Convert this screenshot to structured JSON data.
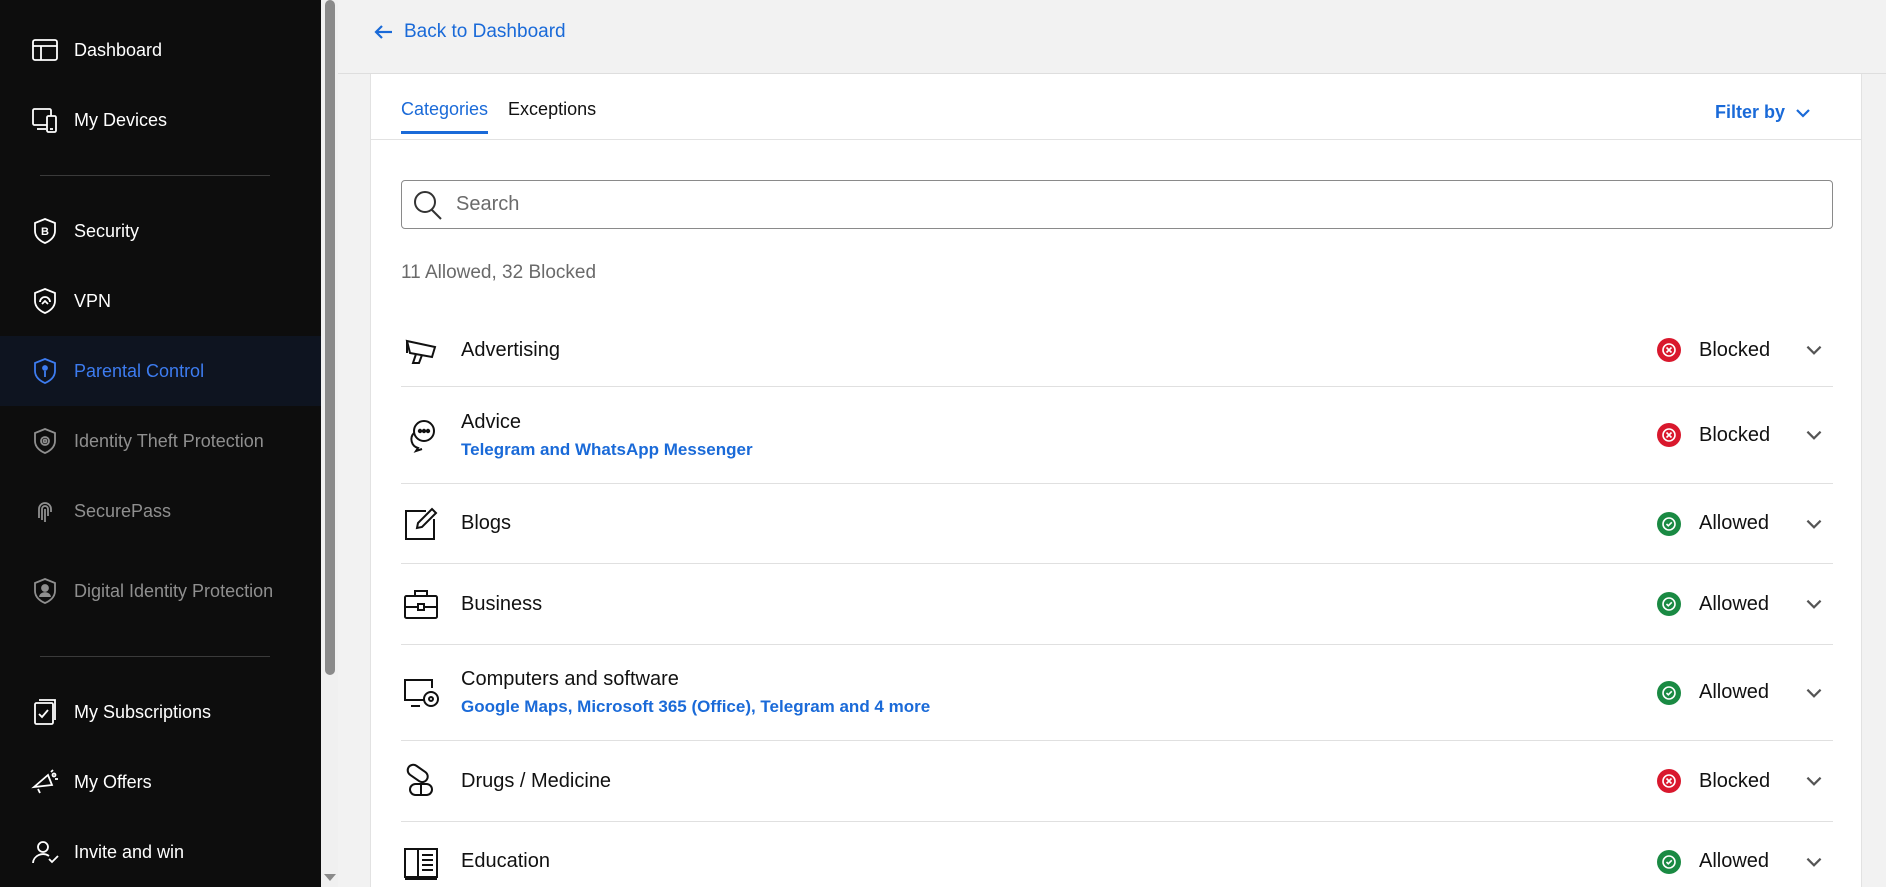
{
  "sidebar": {
    "items": [
      {
        "label": "Dashboard",
        "icon": "dashboard-icon"
      },
      {
        "label": "My Devices",
        "icon": "devices-icon"
      },
      {
        "label": "Security",
        "icon": "security-shield-icon"
      },
      {
        "label": "VPN",
        "icon": "vpn-shield-icon"
      },
      {
        "label": "Parental Control",
        "icon": "parental-shield-icon",
        "active": true
      },
      {
        "label": "Identity Theft Protection",
        "icon": "identity-shield-icon"
      },
      {
        "label": "SecurePass",
        "icon": "fingerprint-icon"
      },
      {
        "label": "Digital Identity Protection",
        "icon": "digital-identity-icon"
      },
      {
        "label": "My Subscriptions",
        "icon": "subscriptions-icon"
      },
      {
        "label": "My Offers",
        "icon": "offers-icon"
      },
      {
        "label": "Invite and win",
        "icon": "invite-icon"
      }
    ]
  },
  "header": {
    "back_label": "Back to Dashboard"
  },
  "tabs": [
    {
      "label": "Categories",
      "active": true
    },
    {
      "label": "Exceptions",
      "active": false
    }
  ],
  "filter_label": "Filter by",
  "search": {
    "placeholder": "Search",
    "value": ""
  },
  "summary": "11 Allowed, 32 Blocked",
  "categories": [
    {
      "name": "Advertising",
      "apps": "",
      "status": "Blocked",
      "icon": "megaphone-icon"
    },
    {
      "name": "Advice",
      "apps": "Telegram and WhatsApp Messenger",
      "status": "Blocked",
      "icon": "chat-advice-icon"
    },
    {
      "name": "Blogs",
      "apps": "",
      "status": "Allowed",
      "icon": "edit-note-icon"
    },
    {
      "name": "Business",
      "apps": "",
      "status": "Allowed",
      "icon": "briefcase-icon"
    },
    {
      "name": "Computers and software",
      "apps": "Google Maps, Microsoft 365 (Office), Telegram and 4 more",
      "status": "Allowed",
      "icon": "computer-disc-icon"
    },
    {
      "name": "Drugs / Medicine",
      "apps": "",
      "status": "Blocked",
      "icon": "pills-icon"
    },
    {
      "name": "Education",
      "apps": "",
      "status": "Allowed",
      "icon": "book-icon"
    }
  ],
  "colors": {
    "accent": "#1a6ad8",
    "blocked": "#d9182d",
    "allowed": "#1a8a43",
    "sidebar_bg": "#0d0d0d"
  }
}
